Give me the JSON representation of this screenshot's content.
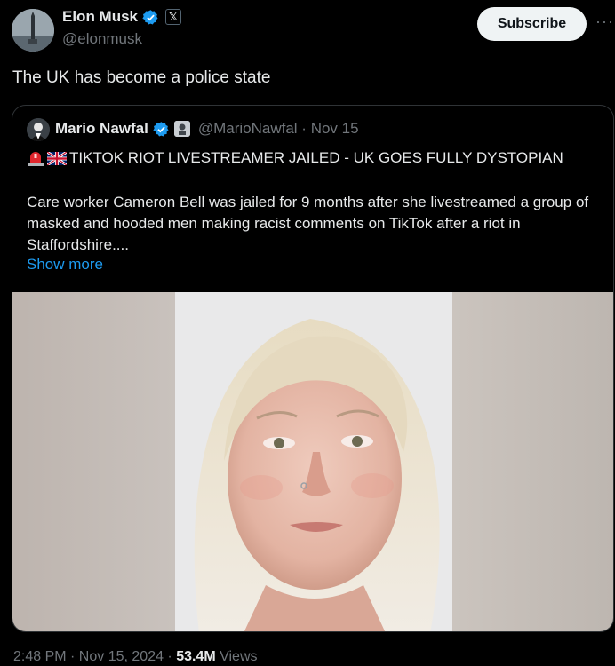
{
  "author": {
    "name": "Elon Musk",
    "handle": "@elonmusk"
  },
  "subscribe_label": "Subscribe",
  "tweet_text": "The UK has become a police state",
  "quote": {
    "name": "Mario Nawfal",
    "handle_date": "@MarioNawfal · Nov 15",
    "headline": "TIKTOK RIOT LIVESTREAMER JAILED - UK GOES FULLY DYSTOPIAN",
    "body": "Care worker Cameron Bell was jailed for 9 months after she livestreamed a group of masked and hooded men making racist comments on TikTok after a riot in Staffordshire....",
    "show_more": "Show more"
  },
  "meta": {
    "timestamp": "2:48 PM · Nov 15, 2024 · ",
    "views_count": "53.4M",
    "views_label": " Views"
  },
  "icons": {
    "verified": "verified-badge-icon",
    "x_affiliate": "x-logo-icon",
    "more": "more-options-icon",
    "siren": "siren-emoji-icon",
    "flag": "uk-flag-icon"
  },
  "colors": {
    "background": "#000000",
    "accent": "#1d9bf0",
    "muted_text": "#71767b",
    "text": "#e7e9ea"
  }
}
